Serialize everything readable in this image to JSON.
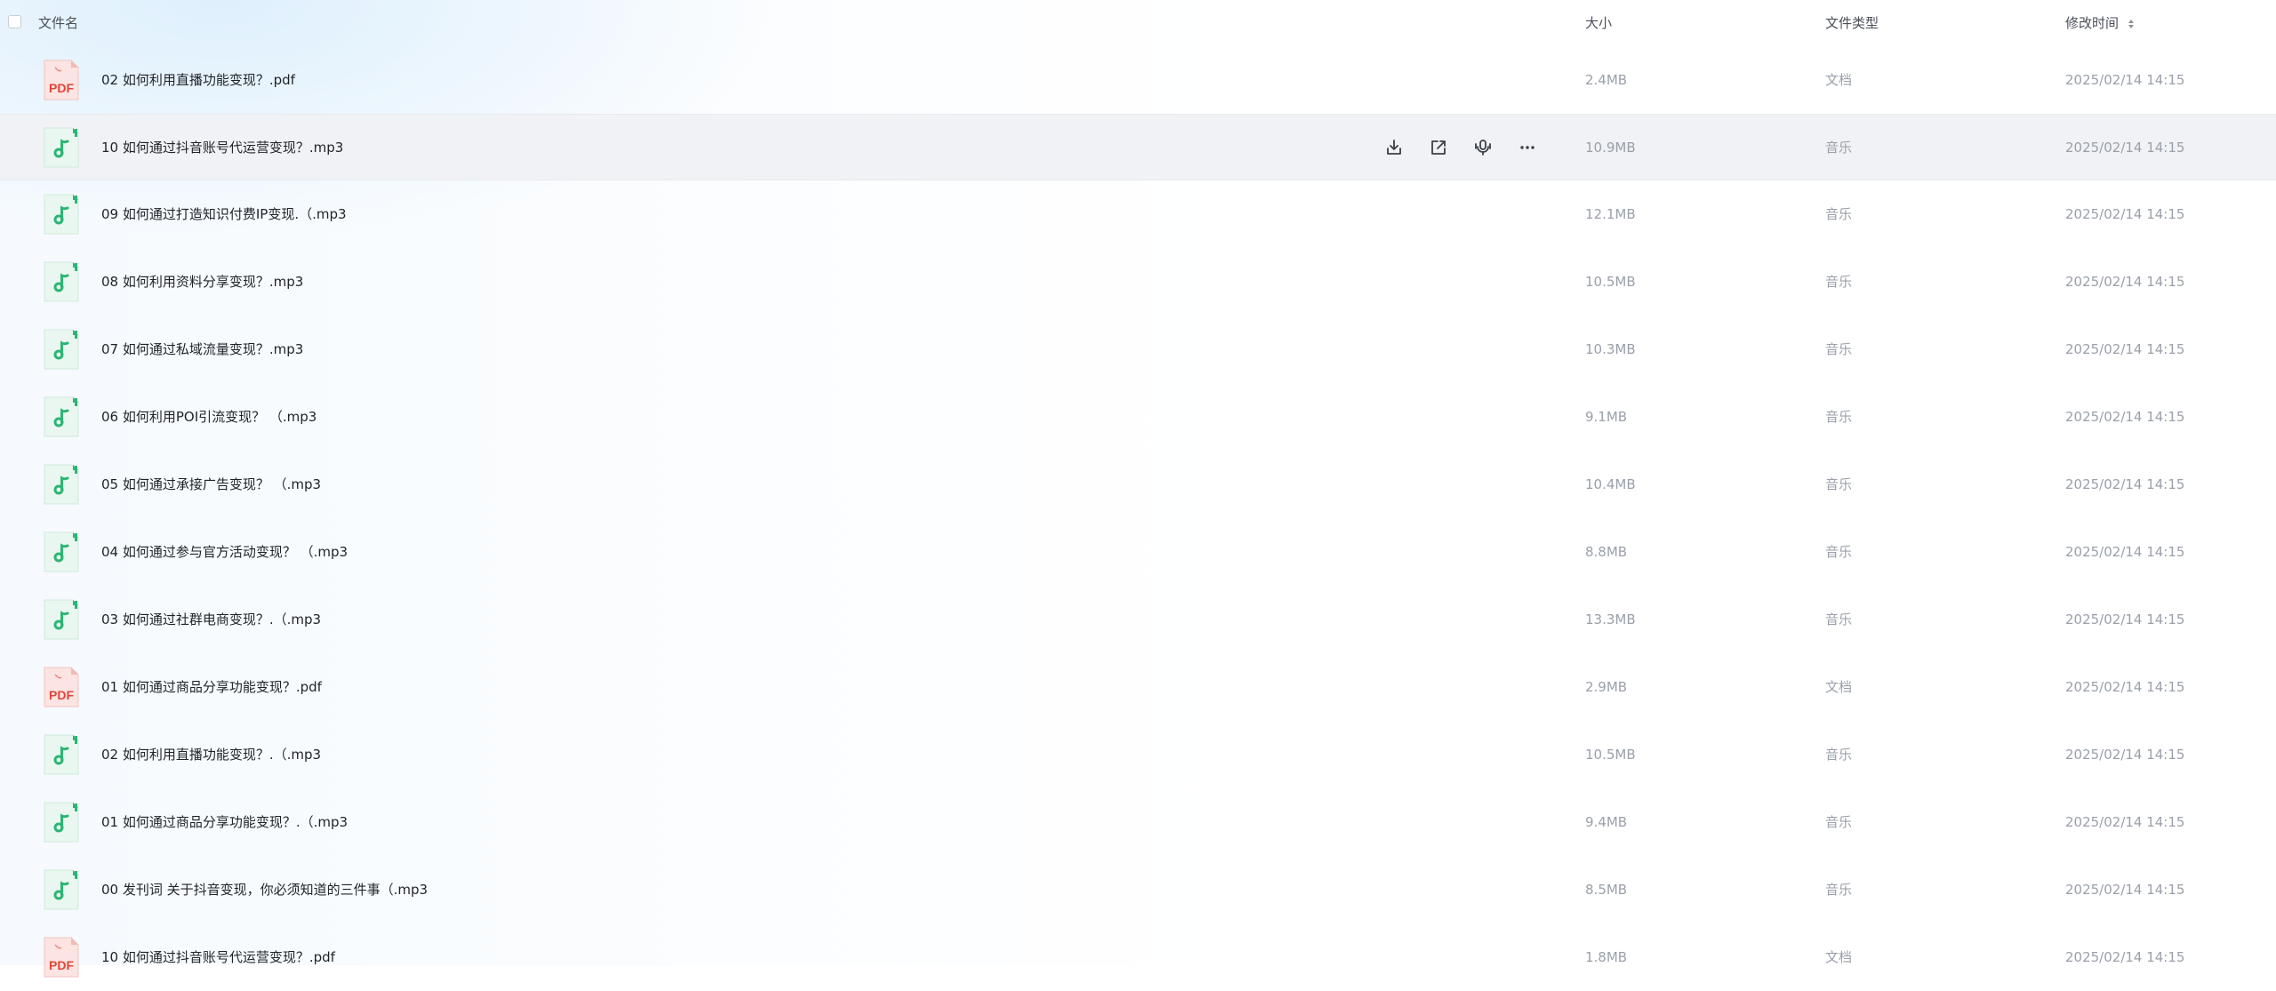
{
  "header": {
    "name_label": "文件名",
    "size_label": "大小",
    "type_label": "文件类型",
    "time_label": "修改时间"
  },
  "colors": {
    "pdf_red": "#e0453a",
    "music_green": "#2bb673",
    "hover_row": "#f1f2f5"
  },
  "files": [
    {
      "name": "02 如何利用直播功能变现？.pdf",
      "size": "2.4MB",
      "type": "文档",
      "modified": "2025/02/14 14:15",
      "icon": "pdf-file-icon"
    },
    {
      "name": "10 如何通过抖音账号代运营变现？.mp3",
      "size": "10.9MB",
      "type": "音乐",
      "modified": "2025/02/14 14:15",
      "icon": "music-file-icon"
    },
    {
      "name": "09 如何通过打造知识付费IP变现.（.mp3",
      "size": "12.1MB",
      "type": "音乐",
      "modified": "2025/02/14 14:15",
      "icon": "music-file-icon"
    },
    {
      "name": "08 如何利用资料分享变现？.mp3",
      "size": "10.5MB",
      "type": "音乐",
      "modified": "2025/02/14 14:15",
      "icon": "music-file-icon"
    },
    {
      "name": "07 如何通过私域流量变现？.mp3",
      "size": "10.3MB",
      "type": "音乐",
      "modified": "2025/02/14 14:15",
      "icon": "music-file-icon"
    },
    {
      "name": "06 如何利用POI引流变现？ （.mp3",
      "size": "9.1MB",
      "type": "音乐",
      "modified": "2025/02/14 14:15",
      "icon": "music-file-icon"
    },
    {
      "name": "05 如何通过承接广告变现？ （.mp3",
      "size": "10.4MB",
      "type": "音乐",
      "modified": "2025/02/14 14:15",
      "icon": "music-file-icon"
    },
    {
      "name": "04 如何通过参与官方活动变现？ （.mp3",
      "size": "8.8MB",
      "type": "音乐",
      "modified": "2025/02/14 14:15",
      "icon": "music-file-icon"
    },
    {
      "name": "03 如何通过社群电商变现？.（.mp3",
      "size": "13.3MB",
      "type": "音乐",
      "modified": "2025/02/14 14:15",
      "icon": "music-file-icon"
    },
    {
      "name": "01 如何通过商品分享功能变现？.pdf",
      "size": "2.9MB",
      "type": "文档",
      "modified": "2025/02/14 14:15",
      "icon": "pdf-file-icon"
    },
    {
      "name": "02 如何利用直播功能变现？.（.mp3",
      "size": "10.5MB",
      "type": "音乐",
      "modified": "2025/02/14 14:15",
      "icon": "music-file-icon"
    },
    {
      "name": "01 如何通过商品分享功能变现？.（.mp3",
      "size": "9.4MB",
      "type": "音乐",
      "modified": "2025/02/14 14:15",
      "icon": "music-file-icon"
    },
    {
      "name": "00 发刊词 关于抖音变现，你必须知道的三件事（.mp3",
      "size": "8.5MB",
      "type": "音乐",
      "modified": "2025/02/14 14:15",
      "icon": "music-file-icon"
    },
    {
      "name": "10 如何通过抖音账号代运营变现？.pdf",
      "size": "1.8MB",
      "type": "文档",
      "modified": "2025/02/14 14:15",
      "icon": "pdf-file-icon"
    }
  ],
  "row_actions": [
    {
      "name": "download-icon",
      "label": "下载"
    },
    {
      "name": "share-icon",
      "label": "分享"
    },
    {
      "name": "audio-to-text-icon",
      "label": "转文字"
    },
    {
      "name": "more-icon",
      "label": "更多"
    }
  ],
  "pdf_badge": "PDF"
}
